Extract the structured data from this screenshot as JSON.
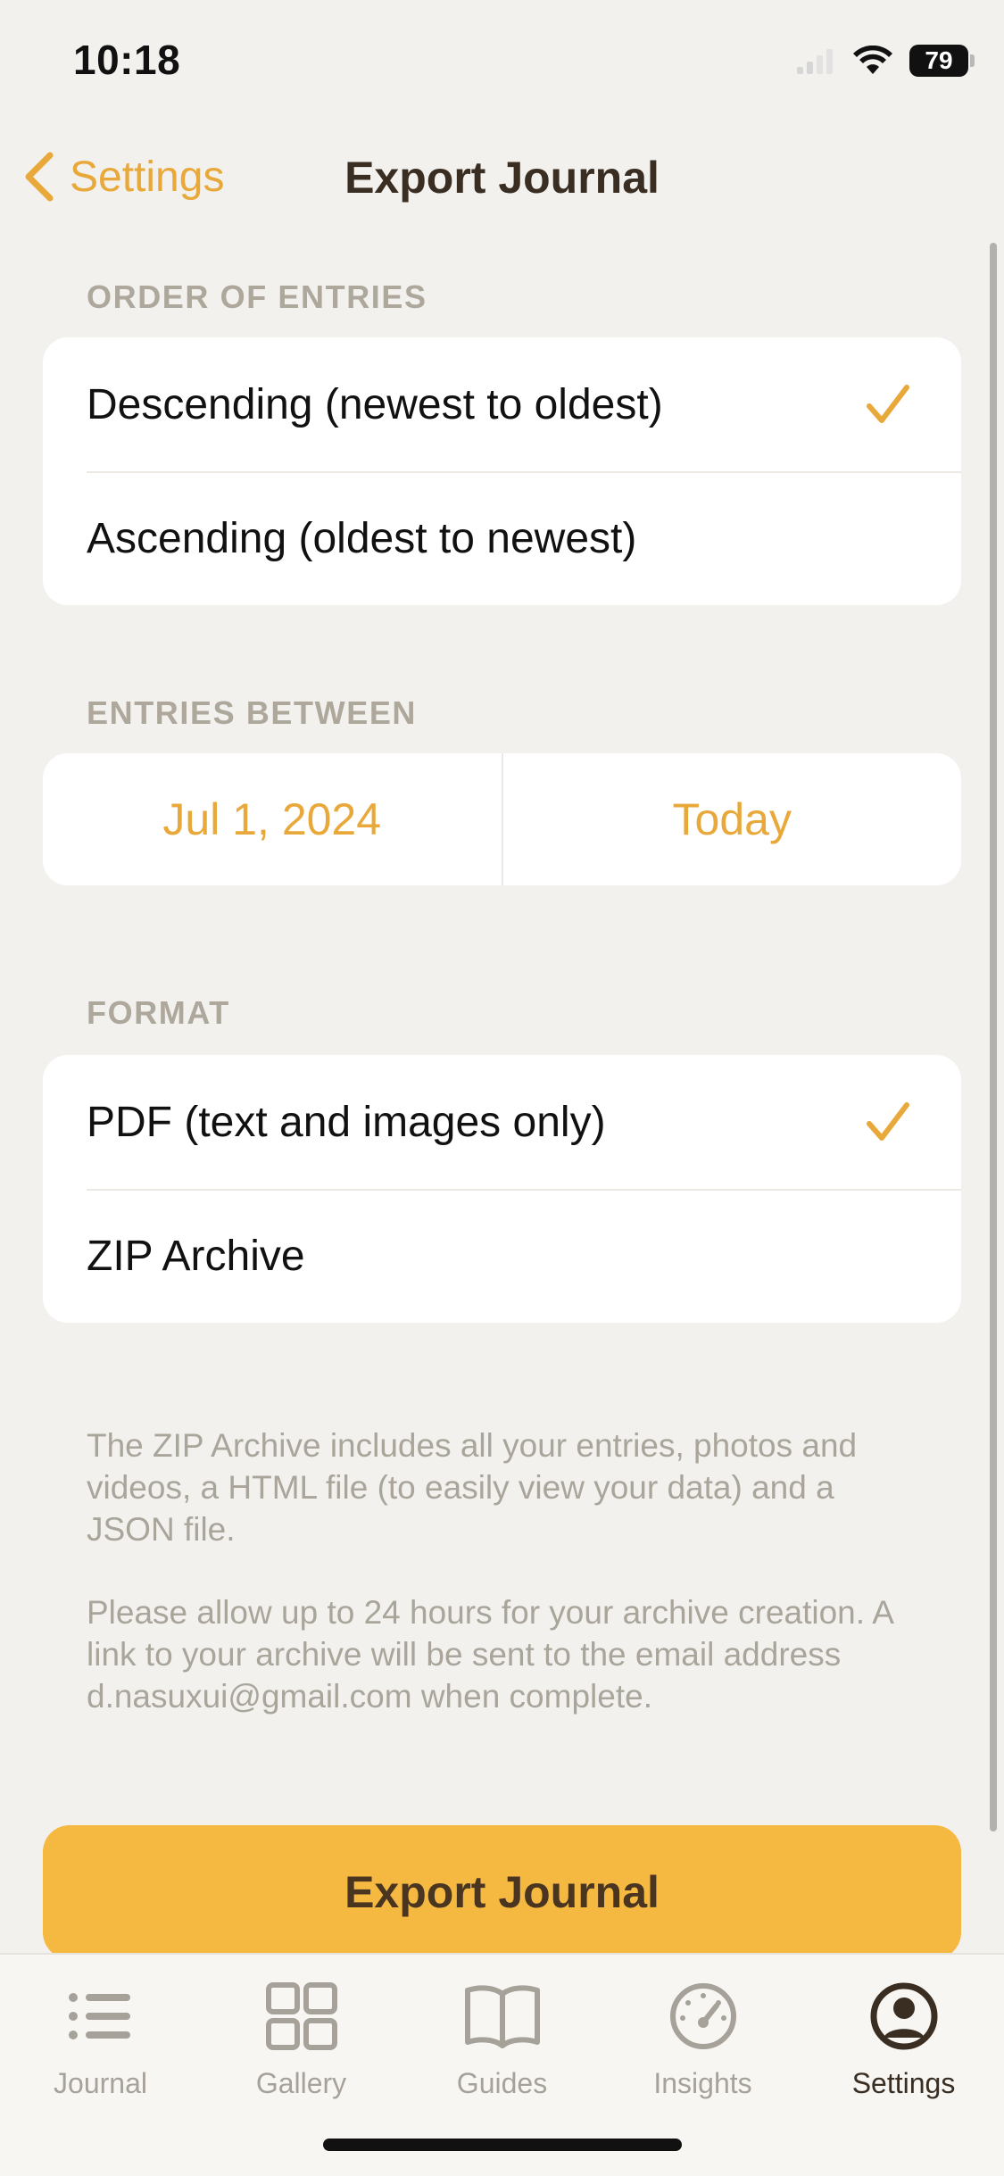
{
  "status_bar": {
    "time": "10:18",
    "battery": "79"
  },
  "nav": {
    "back_label": "Settings",
    "title": "Export Journal"
  },
  "order_section": {
    "header": "ORDER OF ENTRIES",
    "options": [
      {
        "label": "Descending (newest to oldest)",
        "selected": true
      },
      {
        "label": "Ascending (oldest to newest)",
        "selected": false
      }
    ]
  },
  "range_section": {
    "header": "ENTRIES BETWEEN",
    "start": "Jul 1, 2024",
    "end": "Today"
  },
  "format_section": {
    "header": "FORMAT",
    "options": [
      {
        "label": "PDF (text and images only)",
        "selected": true
      },
      {
        "label": "ZIP Archive",
        "selected": false
      }
    ]
  },
  "notes": {
    "zip_info": "The ZIP Archive includes all your entries, photos and videos, a HTML file (to easily view your data) and a JSON file.",
    "archive_info": "Please allow up to 24 hours for your archive creation. A link to your archive will be sent to the email address d.nasuxui@gmail.com when complete."
  },
  "export_button": {
    "label": "Export Journal"
  },
  "tabs": [
    {
      "label": "Journal",
      "icon": "list-icon",
      "active": false
    },
    {
      "label": "Gallery",
      "icon": "grid-icon",
      "active": false
    },
    {
      "label": "Guides",
      "icon": "book-icon",
      "active": false
    },
    {
      "label": "Insights",
      "icon": "gauge-icon",
      "active": false
    },
    {
      "label": "Settings",
      "icon": "person-icon",
      "active": true
    }
  ],
  "colors": {
    "accent": "#e8a83a",
    "button": "#f5b942",
    "background": "#f2f1ee"
  }
}
